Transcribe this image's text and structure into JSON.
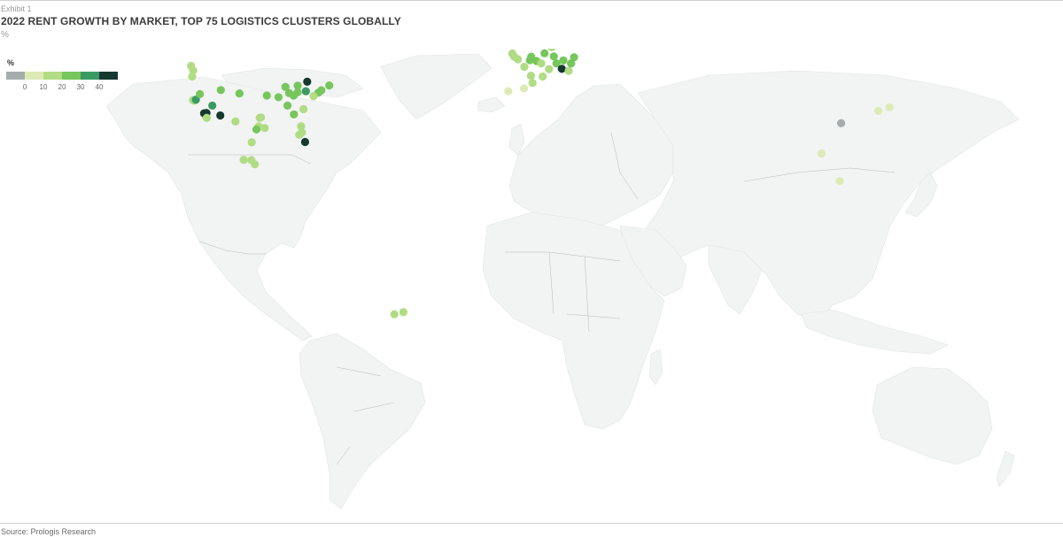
{
  "header": {
    "exhibit": "Exhibit 1",
    "title": "2022 RENT GROWTH BY MARKET, TOP 75 LOGISTICS CLUSTERS GLOBALLY",
    "unit": "%"
  },
  "legend": {
    "title": "%",
    "tick_labels": [
      "0",
      "10",
      "20",
      "30",
      "40"
    ],
    "colors": [
      "#a4acac",
      "#dcebb5",
      "#b0dc84",
      "#76c65c",
      "#3a9a64",
      "#16392f"
    ]
  },
  "source": "Source: Prologis Research",
  "map_colors": {
    "land": "#f2f3f3",
    "border": "#b6b8b8"
  },
  "chart_data": {
    "type": "scatter",
    "description_values": "rent growth % by logistics market (approximate, read off color scale)",
    "color_scale": {
      "min": 0,
      "max": 40,
      "below_zero_color": "#a4acac"
    },
    "markets": [
      {
        "region": "us-west",
        "lon": -123.1,
        "lat": 49.2,
        "value": 14
      },
      {
        "region": "us-west",
        "lon": -122.3,
        "lat": 47.6,
        "value": 12
      },
      {
        "region": "us-west",
        "lon": -122.7,
        "lat": 45.5,
        "value": 13
      },
      {
        "region": "us-west",
        "lon": -122.4,
        "lat": 37.8,
        "value": 13
      },
      {
        "region": "us-west",
        "lon": -121.9,
        "lat": 37.6,
        "value": 16
      },
      {
        "region": "us-west",
        "lon": -121.3,
        "lat": 37.9,
        "value": 38
      },
      {
        "region": "us-west",
        "lon": -119.8,
        "lat": 39.5,
        "value": 26
      },
      {
        "region": "us-west",
        "lon": -118.2,
        "lat": 34.0,
        "value": 42
      },
      {
        "region": "us-west",
        "lon": -117.3,
        "lat": 34.1,
        "value": 44
      },
      {
        "region": "us-west",
        "lon": -117.2,
        "lat": 32.7,
        "value": 13
      },
      {
        "region": "us-west",
        "lon": -115.1,
        "lat": 36.2,
        "value": 32
      },
      {
        "region": "us-west",
        "lon": -112.1,
        "lat": 33.4,
        "value": 44
      },
      {
        "region": "us-west",
        "lon": -111.9,
        "lat": 40.8,
        "value": 28
      },
      {
        "region": "us-central",
        "lon": -104.9,
        "lat": 39.7,
        "value": 24
      },
      {
        "region": "us-south",
        "lon": -96.8,
        "lat": 32.8,
        "value": 16
      },
      {
        "region": "us-south",
        "lon": -97.3,
        "lat": 32.7,
        "value": 18
      },
      {
        "region": "us-south",
        "lon": -97.7,
        "lat": 30.3,
        "value": 12
      },
      {
        "region": "us-south",
        "lon": -95.4,
        "lat": 29.8,
        "value": 14
      },
      {
        "region": "us-south",
        "lon": -98.5,
        "lat": 29.4,
        "value": 22
      },
      {
        "region": "us-central",
        "lon": -94.6,
        "lat": 39.1,
        "value": 20
      },
      {
        "region": "us-central",
        "lon": -90.2,
        "lat": 38.6,
        "value": 22
      },
      {
        "region": "us-central",
        "lon": -87.6,
        "lat": 41.9,
        "value": 22
      },
      {
        "region": "us-central",
        "lon": -86.2,
        "lat": 39.8,
        "value": 24
      },
      {
        "region": "us-central",
        "lon": -83.0,
        "lat": 40.0,
        "value": 22
      },
      {
        "region": "us-central",
        "lon": -84.5,
        "lat": 39.1,
        "value": 22
      },
      {
        "region": "us-central",
        "lon": -83.0,
        "lat": 42.3,
        "value": 24
      },
      {
        "region": "us-east",
        "lon": -79.4,
        "lat": 43.7,
        "value": 42
      },
      {
        "region": "us-east",
        "lon": -79.9,
        "lat": 40.4,
        "value": 33
      },
      {
        "region": "us-east",
        "lon": -75.2,
        "lat": 39.9,
        "value": 24
      },
      {
        "region": "us-east",
        "lon": -74.1,
        "lat": 40.7,
        "value": 24
      },
      {
        "region": "us-east",
        "lon": -71.1,
        "lat": 42.4,
        "value": 24
      },
      {
        "region": "us-east",
        "lon": -77.0,
        "lat": 38.9,
        "value": 16
      },
      {
        "region": "us-east",
        "lon": -86.8,
        "lat": 36.2,
        "value": 20
      },
      {
        "region": "us-east",
        "lon": -80.8,
        "lat": 35.2,
        "value": 14
      },
      {
        "region": "us-east",
        "lon": -84.4,
        "lat": 33.7,
        "value": 22
      },
      {
        "region": "us-east",
        "lon": -81.7,
        "lat": 30.3,
        "value": 16
      },
      {
        "region": "us-east",
        "lon": -82.4,
        "lat": 27.9,
        "value": 14
      },
      {
        "region": "us-east",
        "lon": -81.4,
        "lat": 28.5,
        "value": 18
      },
      {
        "region": "us-east",
        "lon": -80.2,
        "lat": 25.8,
        "value": 44
      },
      {
        "region": "mexico",
        "lon": -100.3,
        "lat": 25.7,
        "value": 14
      },
      {
        "region": "mexico",
        "lon": -106.4,
        "lat": 31.7,
        "value": 12
      },
      {
        "region": "mexico",
        "lon": -103.3,
        "lat": 20.7,
        "value": 14
      },
      {
        "region": "mexico",
        "lon": -99.1,
        "lat": 19.4,
        "value": 14
      },
      {
        "region": "mexico",
        "lon": -100.4,
        "lat": 20.6,
        "value": 18
      },
      {
        "region": "brazil",
        "lon": -46.6,
        "lat": -23.5,
        "value": 14
      },
      {
        "region": "brazil",
        "lon": -43.2,
        "lat": -22.9,
        "value": 14
      },
      {
        "region": "europe",
        "lon": -3.7,
        "lat": 40.4,
        "value": 8
      },
      {
        "region": "europe",
        "lon": 2.2,
        "lat": 41.4,
        "value": 8
      },
      {
        "region": "europe",
        "lon": 9.2,
        "lat": 45.5,
        "value": 18
      },
      {
        "region": "europe",
        "lon": 4.8,
        "lat": 45.8,
        "value": 14
      },
      {
        "region": "europe",
        "lon": 5.4,
        "lat": 43.3,
        "value": 12
      },
      {
        "region": "europe",
        "lon": 2.3,
        "lat": 48.9,
        "value": 16
      },
      {
        "region": "europe",
        "lon": -0.1,
        "lat": 51.5,
        "value": 14
      },
      {
        "region": "europe",
        "lon": -2.2,
        "lat": 53.5,
        "value": 16
      },
      {
        "region": "europe",
        "lon": -1.5,
        "lat": 52.4,
        "value": 18
      },
      {
        "region": "europe",
        "lon": 4.4,
        "lat": 51.2,
        "value": 28
      },
      {
        "region": "europe",
        "lon": 4.9,
        "lat": 52.4,
        "value": 22
      },
      {
        "region": "europe",
        "lon": 6.9,
        "lat": 50.9,
        "value": 20
      },
      {
        "region": "europe",
        "lon": 8.7,
        "lat": 50.1,
        "value": 16
      },
      {
        "region": "europe",
        "lon": 9.9,
        "lat": 53.6,
        "value": 24
      },
      {
        "region": "europe",
        "lon": 13.4,
        "lat": 52.5,
        "value": 28
      },
      {
        "region": "europe",
        "lon": 11.6,
        "lat": 48.1,
        "value": 18
      },
      {
        "region": "europe",
        "lon": 14.4,
        "lat": 50.1,
        "value": 22
      },
      {
        "region": "europe",
        "lon": 16.4,
        "lat": 48.2,
        "value": 42
      },
      {
        "region": "europe",
        "lon": 19.0,
        "lat": 47.5,
        "value": 18
      },
      {
        "region": "europe",
        "lon": 21.0,
        "lat": 52.2,
        "value": 28
      },
      {
        "region": "europe",
        "lon": 19.9,
        "lat": 50.1,
        "value": 22
      },
      {
        "region": "europe",
        "lon": 18.1,
        "lat": 59.3,
        "value": 18
      },
      {
        "region": "europe",
        "lon": 12.6,
        "lat": 55.7,
        "value": 18
      },
      {
        "region": "europe",
        "lon": 17.0,
        "lat": 51.1,
        "value": 22
      },
      {
        "region": "asia",
        "lon": 121.5,
        "lat": 31.2,
        "value": -2
      },
      {
        "region": "asia",
        "lon": 114.1,
        "lat": 22.5,
        "value": 6
      },
      {
        "region": "asia",
        "lon": 121.0,
        "lat": 14.6,
        "value": 6
      },
      {
        "region": "asia",
        "lon": 135.5,
        "lat": 34.7,
        "value": 6
      },
      {
        "region": "asia",
        "lon": 139.7,
        "lat": 35.7,
        "value": 6
      }
    ]
  }
}
